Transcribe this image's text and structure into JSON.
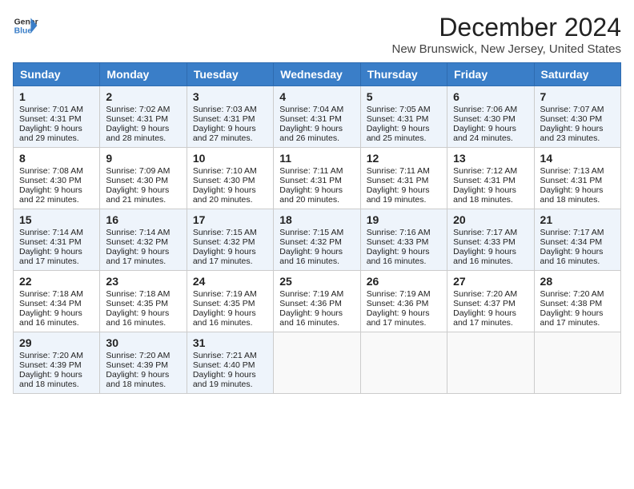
{
  "logo": {
    "line1": "General",
    "line2": "Blue"
  },
  "title": "December 2024",
  "subtitle": "New Brunswick, New Jersey, United States",
  "days_of_week": [
    "Sunday",
    "Monday",
    "Tuesday",
    "Wednesday",
    "Thursday",
    "Friday",
    "Saturday"
  ],
  "weeks": [
    [
      {
        "day": 1,
        "sunrise": "7:01 AM",
        "sunset": "4:31 PM",
        "daylight": "9 hours and 29 minutes."
      },
      {
        "day": 2,
        "sunrise": "7:02 AM",
        "sunset": "4:31 PM",
        "daylight": "9 hours and 28 minutes."
      },
      {
        "day": 3,
        "sunrise": "7:03 AM",
        "sunset": "4:31 PM",
        "daylight": "9 hours and 27 minutes."
      },
      {
        "day": 4,
        "sunrise": "7:04 AM",
        "sunset": "4:31 PM",
        "daylight": "9 hours and 26 minutes."
      },
      {
        "day": 5,
        "sunrise": "7:05 AM",
        "sunset": "4:31 PM",
        "daylight": "9 hours and 25 minutes."
      },
      {
        "day": 6,
        "sunrise": "7:06 AM",
        "sunset": "4:30 PM",
        "daylight": "9 hours and 24 minutes."
      },
      {
        "day": 7,
        "sunrise": "7:07 AM",
        "sunset": "4:30 PM",
        "daylight": "9 hours and 23 minutes."
      }
    ],
    [
      {
        "day": 8,
        "sunrise": "7:08 AM",
        "sunset": "4:30 PM",
        "daylight": "9 hours and 22 minutes."
      },
      {
        "day": 9,
        "sunrise": "7:09 AM",
        "sunset": "4:30 PM",
        "daylight": "9 hours and 21 minutes."
      },
      {
        "day": 10,
        "sunrise": "7:10 AM",
        "sunset": "4:30 PM",
        "daylight": "9 hours and 20 minutes."
      },
      {
        "day": 11,
        "sunrise": "7:11 AM",
        "sunset": "4:31 PM",
        "daylight": "9 hours and 20 minutes."
      },
      {
        "day": 12,
        "sunrise": "7:11 AM",
        "sunset": "4:31 PM",
        "daylight": "9 hours and 19 minutes."
      },
      {
        "day": 13,
        "sunrise": "7:12 AM",
        "sunset": "4:31 PM",
        "daylight": "9 hours and 18 minutes."
      },
      {
        "day": 14,
        "sunrise": "7:13 AM",
        "sunset": "4:31 PM",
        "daylight": "9 hours and 18 minutes."
      }
    ],
    [
      {
        "day": 15,
        "sunrise": "7:14 AM",
        "sunset": "4:31 PM",
        "daylight": "9 hours and 17 minutes."
      },
      {
        "day": 16,
        "sunrise": "7:14 AM",
        "sunset": "4:32 PM",
        "daylight": "9 hours and 17 minutes."
      },
      {
        "day": 17,
        "sunrise": "7:15 AM",
        "sunset": "4:32 PM",
        "daylight": "9 hours and 17 minutes."
      },
      {
        "day": 18,
        "sunrise": "7:15 AM",
        "sunset": "4:32 PM",
        "daylight": "9 hours and 16 minutes."
      },
      {
        "day": 19,
        "sunrise": "7:16 AM",
        "sunset": "4:33 PM",
        "daylight": "9 hours and 16 minutes."
      },
      {
        "day": 20,
        "sunrise": "7:17 AM",
        "sunset": "4:33 PM",
        "daylight": "9 hours and 16 minutes."
      },
      {
        "day": 21,
        "sunrise": "7:17 AM",
        "sunset": "4:34 PM",
        "daylight": "9 hours and 16 minutes."
      }
    ],
    [
      {
        "day": 22,
        "sunrise": "7:18 AM",
        "sunset": "4:34 PM",
        "daylight": "9 hours and 16 minutes."
      },
      {
        "day": 23,
        "sunrise": "7:18 AM",
        "sunset": "4:35 PM",
        "daylight": "9 hours and 16 minutes."
      },
      {
        "day": 24,
        "sunrise": "7:19 AM",
        "sunset": "4:35 PM",
        "daylight": "9 hours and 16 minutes."
      },
      {
        "day": 25,
        "sunrise": "7:19 AM",
        "sunset": "4:36 PM",
        "daylight": "9 hours and 16 minutes."
      },
      {
        "day": 26,
        "sunrise": "7:19 AM",
        "sunset": "4:36 PM",
        "daylight": "9 hours and 17 minutes."
      },
      {
        "day": 27,
        "sunrise": "7:20 AM",
        "sunset": "4:37 PM",
        "daylight": "9 hours and 17 minutes."
      },
      {
        "day": 28,
        "sunrise": "7:20 AM",
        "sunset": "4:38 PM",
        "daylight": "9 hours and 17 minutes."
      }
    ],
    [
      {
        "day": 29,
        "sunrise": "7:20 AM",
        "sunset": "4:39 PM",
        "daylight": "9 hours and 18 minutes."
      },
      {
        "day": 30,
        "sunrise": "7:20 AM",
        "sunset": "4:39 PM",
        "daylight": "9 hours and 18 minutes."
      },
      {
        "day": 31,
        "sunrise": "7:21 AM",
        "sunset": "4:40 PM",
        "daylight": "9 hours and 19 minutes."
      },
      null,
      null,
      null,
      null
    ]
  ],
  "week1_start_col": 0,
  "labels": {
    "sunrise": "Sunrise:",
    "sunset": "Sunset:",
    "daylight": "Daylight:"
  }
}
